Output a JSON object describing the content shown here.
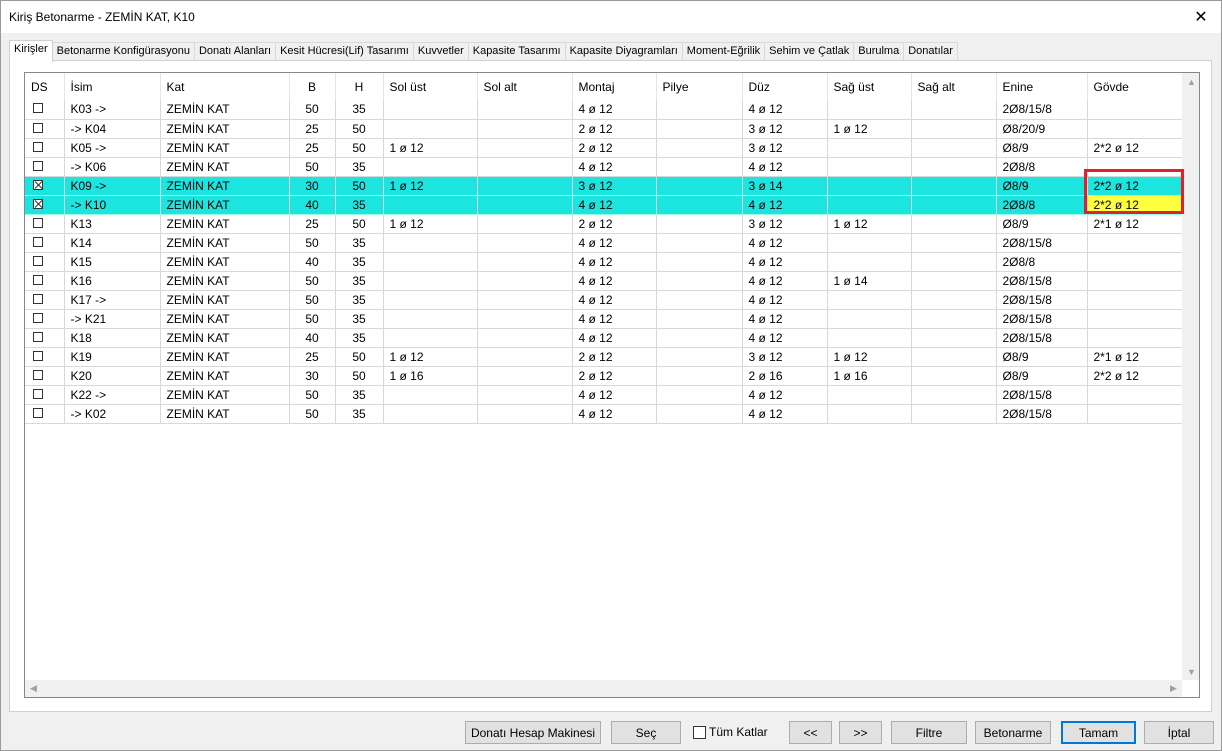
{
  "window": {
    "title": "Kiriş Betonarme - ZEMİN KAT, K10",
    "close_glyph": "✕"
  },
  "tabs": [
    {
      "label": "Kirişler",
      "active": true
    },
    {
      "label": "Betonarme Konfigürasyonu"
    },
    {
      "label": "Donatı Alanları"
    },
    {
      "label": "Kesit Hücresi(Lif) Tasarımı"
    },
    {
      "label": "Kuvvetler"
    },
    {
      "label": "Kapasite Tasarımı"
    },
    {
      "label": "Kapasite Diyagramları"
    },
    {
      "label": "Moment-Eğrilik"
    },
    {
      "label": "Sehim ve Çatlak"
    },
    {
      "label": "Burulma"
    },
    {
      "label": "Donatılar"
    }
  ],
  "columns": [
    "DS",
    "İsim",
    "Kat",
    "B",
    "H",
    "Sol üst",
    "Sol alt",
    "Montaj",
    "Pilye",
    "Düz",
    "Sağ üst",
    "Sağ alt",
    "Enine",
    "Gövde"
  ],
  "rows": [
    {
      "ds": false,
      "isim": "K03 ->",
      "kat": "ZEMİN KAT",
      "b": "50",
      "h": "35",
      "sol_ust": "",
      "sol_alt": "",
      "montaj": "4 ø 12",
      "pilye": "",
      "duz": "4 ø 12",
      "sag_ust": "",
      "sag_alt": "",
      "enine": "2Ø8/15/8",
      "govde": ""
    },
    {
      "ds": false,
      "isim": "-> K04",
      "kat": "ZEMİN KAT",
      "b": "25",
      "h": "50",
      "sol_ust": "",
      "sol_alt": "",
      "montaj": "2 ø 12",
      "pilye": "",
      "duz": "3 ø 12",
      "sag_ust": "1 ø 12",
      "sag_alt": "",
      "enine": "Ø8/20/9",
      "govde": ""
    },
    {
      "ds": false,
      "isim": "K05 ->",
      "kat": "ZEMİN KAT",
      "b": "25",
      "h": "50",
      "sol_ust": "1 ø 12",
      "sol_alt": "",
      "montaj": "2 ø 12",
      "pilye": "",
      "duz": "3 ø 12",
      "sag_ust": "",
      "sag_alt": "",
      "enine": "Ø8/9",
      "govde": "2*2 ø 12"
    },
    {
      "ds": false,
      "isim": "-> K06",
      "kat": "ZEMİN KAT",
      "b": "50",
      "h": "35",
      "sol_ust": "",
      "sol_alt": "",
      "montaj": "4 ø 12",
      "pilye": "",
      "duz": "4 ø 12",
      "sag_ust": "",
      "sag_alt": "",
      "enine": "2Ø8/8",
      "govde": ""
    },
    {
      "ds": true,
      "sel": true,
      "isim": "K09 ->",
      "kat": "ZEMİN KAT",
      "b": "30",
      "h": "50",
      "sol_ust": "1 ø 12",
      "sol_alt": "",
      "montaj": "3 ø 12",
      "pilye": "",
      "duz": "3 ø 14",
      "sag_ust": "",
      "sag_alt": "",
      "enine": "Ø8/9",
      "govde": "2*2 ø 12"
    },
    {
      "ds": true,
      "sel": true,
      "current": true,
      "isim": "-> K10",
      "kat": "ZEMİN KAT",
      "b": "40",
      "h": "35",
      "sol_ust": "",
      "sol_alt": "",
      "montaj": "4 ø 12",
      "pilye": "",
      "duz": "4 ø 12",
      "sag_ust": "",
      "sag_alt": "",
      "enine": "2Ø8/8",
      "govde": "2*2 ø 12"
    },
    {
      "ds": false,
      "isim": "K13",
      "kat": "ZEMİN KAT",
      "b": "25",
      "h": "50",
      "sol_ust": "1 ø 12",
      "sol_alt": "",
      "montaj": "2 ø 12",
      "pilye": "",
      "duz": "3 ø 12",
      "sag_ust": "1 ø 12",
      "sag_alt": "",
      "enine": "Ø8/9",
      "govde": "2*1 ø 12"
    },
    {
      "ds": false,
      "isim": "K14",
      "kat": "ZEMİN KAT",
      "b": "50",
      "h": "35",
      "sol_ust": "",
      "sol_alt": "",
      "montaj": "4 ø 12",
      "pilye": "",
      "duz": "4 ø 12",
      "sag_ust": "",
      "sag_alt": "",
      "enine": "2Ø8/15/8",
      "govde": ""
    },
    {
      "ds": false,
      "isim": "K15",
      "kat": "ZEMİN KAT",
      "b": "40",
      "h": "35",
      "sol_ust": "",
      "sol_alt": "",
      "montaj": "4 ø 12",
      "pilye": "",
      "duz": "4 ø 12",
      "sag_ust": "",
      "sag_alt": "",
      "enine": "2Ø8/8",
      "govde": ""
    },
    {
      "ds": false,
      "isim": "K16",
      "kat": "ZEMİN KAT",
      "b": "50",
      "h": "35",
      "sol_ust": "",
      "sol_alt": "",
      "montaj": "4 ø 12",
      "pilye": "",
      "duz": "4 ø 12",
      "sag_ust": "1 ø 14",
      "sag_alt": "",
      "enine": "2Ø8/15/8",
      "govde": ""
    },
    {
      "ds": false,
      "isim": "K17 ->",
      "kat": "ZEMİN KAT",
      "b": "50",
      "h": "35",
      "sol_ust": "",
      "sol_alt": "",
      "montaj": "4 ø 12",
      "pilye": "",
      "duz": "4 ø 12",
      "sag_ust": "",
      "sag_alt": "",
      "enine": "2Ø8/15/8",
      "govde": ""
    },
    {
      "ds": false,
      "isim": "-> K21",
      "kat": "ZEMİN KAT",
      "b": "50",
      "h": "35",
      "sol_ust": "",
      "sol_alt": "",
      "montaj": "4 ø 12",
      "pilye": "",
      "duz": "4 ø 12",
      "sag_ust": "",
      "sag_alt": "",
      "enine": "2Ø8/15/8",
      "govde": ""
    },
    {
      "ds": false,
      "isim": "K18",
      "kat": "ZEMİN KAT",
      "b": "40",
      "h": "35",
      "sol_ust": "",
      "sol_alt": "",
      "montaj": "4 ø 12",
      "pilye": "",
      "duz": "4 ø 12",
      "sag_ust": "",
      "sag_alt": "",
      "enine": "2Ø8/15/8",
      "govde": ""
    },
    {
      "ds": false,
      "isim": "K19",
      "kat": "ZEMİN KAT",
      "b": "25",
      "h": "50",
      "sol_ust": "1 ø 12",
      "sol_alt": "",
      "montaj": "2 ø 12",
      "pilye": "",
      "duz": "3 ø 12",
      "sag_ust": "1 ø 12",
      "sag_alt": "",
      "enine": "Ø8/9",
      "govde": "2*1 ø 12"
    },
    {
      "ds": false,
      "isim": "K20",
      "kat": "ZEMİN KAT",
      "b": "30",
      "h": "50",
      "sol_ust": "1 ø 16",
      "sol_alt": "",
      "montaj": "2 ø 12",
      "pilye": "",
      "duz": "2 ø 16",
      "sag_ust": "1 ø 16",
      "sag_alt": "",
      "enine": "Ø8/9",
      "govde": "2*2 ø 12"
    },
    {
      "ds": false,
      "isim": "K22 ->",
      "kat": "ZEMİN KAT",
      "b": "50",
      "h": "35",
      "sol_ust": "",
      "sol_alt": "",
      "montaj": "4 ø 12",
      "pilye": "",
      "duz": "4 ø 12",
      "sag_ust": "",
      "sag_alt": "",
      "enine": "2Ø8/15/8",
      "govde": ""
    },
    {
      "ds": false,
      "isim": "-> K02",
      "kat": "ZEMİN KAT",
      "b": "50",
      "h": "35",
      "sol_ust": "",
      "sol_alt": "",
      "montaj": "4 ø 12",
      "pilye": "",
      "duz": "4 ø 12",
      "sag_ust": "",
      "sag_alt": "",
      "enine": "2Ø8/15/8",
      "govde": ""
    }
  ],
  "buttons": {
    "calculator": "Donatı Hesap Makinesi",
    "select": "Seç",
    "all_floors": "Tüm Katlar",
    "prev": "<<",
    "next": ">>",
    "filter": "Filtre",
    "reinforce": "Betonarme",
    "ok": "Tamam",
    "cancel": "İptal"
  },
  "all_floors_checked": false,
  "colors": {
    "selection": "#1ce5e0",
    "current_cell": "#ffff40",
    "highlight_border": "#e0202a"
  }
}
